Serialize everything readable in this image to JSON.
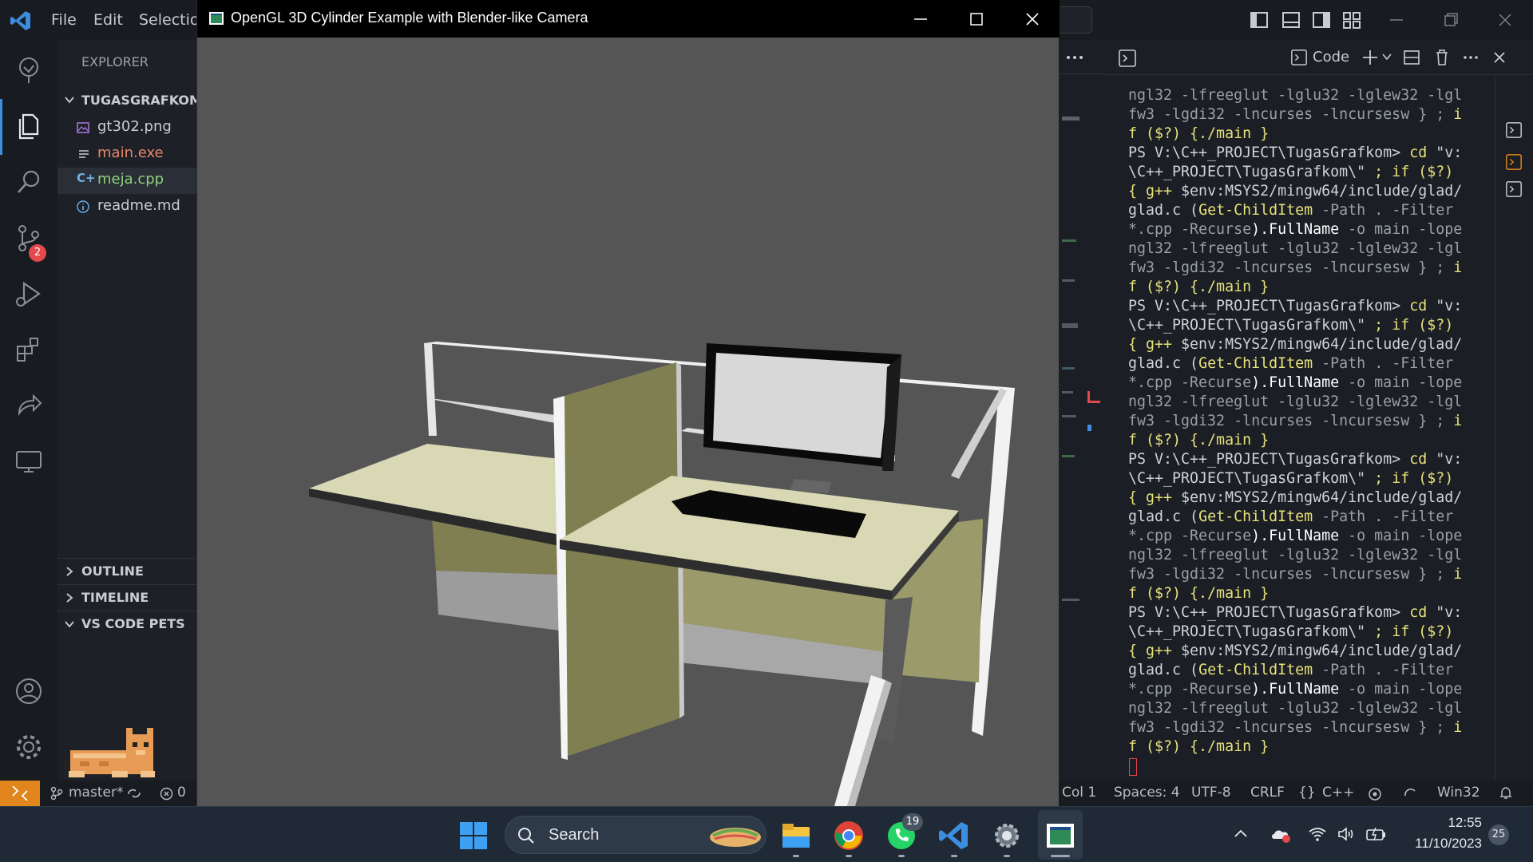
{
  "vscode": {
    "menu": [
      "File",
      "Edit",
      "Selectio"
    ],
    "explorer": {
      "header": "EXPLORER",
      "folder": "TUGASGRAFKOM",
      "files": [
        {
          "name": "gt302.png",
          "color": "#c9ccd2"
        },
        {
          "name": "main.exe",
          "color": "#e8866b"
        },
        {
          "name": "meja.cpp",
          "color": "#8fd17b"
        },
        {
          "name": "readme.md",
          "color": "#c9ccd2"
        }
      ],
      "sections": [
        "OUTLINE",
        "TIMELINE",
        "VS CODE PETS"
      ]
    },
    "scm_badge": "2",
    "terminal": {
      "profile_label": "Code",
      "lines": [
        [
          {
            "t": "ngl32 -lfreeglut -lglu32 -lglew32 -lgl",
            "c": "g"
          }
        ],
        [
          {
            "t": "fw3 -lgdi32 -lncurses -lncursesw } ; ",
            "c": "g"
          },
          {
            "t": "i",
            "c": "y"
          }
        ],
        [
          {
            "t": "f ($?) {./main }",
            "c": "y"
          }
        ],
        [
          {
            "t": "PS V:\\C++_PROJECT\\TugasGrafkom> ",
            "c": "n"
          },
          {
            "t": "cd ",
            "c": "y"
          },
          {
            "t": "\"v:",
            "c": "n"
          }
        ],
        [
          {
            "t": "\\C++_PROJECT\\TugasGrafkom\\\"",
            "c": "n"
          },
          {
            "t": " ; if ($?)",
            "c": "y"
          }
        ],
        [
          {
            "t": "{ g++ ",
            "c": "y"
          },
          {
            "t": "$env:MSYS2/mingw64/include/glad/",
            "c": "n"
          }
        ],
        [
          {
            "t": "glad.c (",
            "c": "n"
          },
          {
            "t": "Get-ChildItem",
            "c": "y"
          },
          {
            "t": " -Path . -Filter",
            "c": "g"
          }
        ],
        [
          {
            "t": "*.cpp -Recurse",
            "c": "g"
          },
          {
            "t": ").FullName",
            "c": "w"
          },
          {
            "t": " -o main -lope",
            "c": "g"
          }
        ],
        [
          {
            "t": "ngl32 -lfreeglut -lglu32 -lglew32 -lgl",
            "c": "g"
          }
        ],
        [
          {
            "t": "fw3 -lgdi32 -lncurses -lncursesw } ; ",
            "c": "g"
          },
          {
            "t": "i",
            "c": "y"
          }
        ],
        [
          {
            "t": "f ($?) {./main }",
            "c": "y"
          }
        ],
        [
          {
            "t": "PS V:\\C++_PROJECT\\TugasGrafkom> ",
            "c": "n"
          },
          {
            "t": "cd ",
            "c": "y"
          },
          {
            "t": "\"v:",
            "c": "n"
          }
        ],
        [
          {
            "t": "\\C++_PROJECT\\TugasGrafkom\\\"",
            "c": "n"
          },
          {
            "t": " ; if ($?)",
            "c": "y"
          }
        ],
        [
          {
            "t": "{ g++ ",
            "c": "y"
          },
          {
            "t": "$env:MSYS2/mingw64/include/glad/",
            "c": "n"
          }
        ],
        [
          {
            "t": "glad.c (",
            "c": "n"
          },
          {
            "t": "Get-ChildItem",
            "c": "y"
          },
          {
            "t": " -Path . -Filter",
            "c": "g"
          }
        ],
        [
          {
            "t": "*.cpp -Recurse",
            "c": "g"
          },
          {
            "t": ").FullName",
            "c": "w"
          },
          {
            "t": " -o main -lope",
            "c": "g"
          }
        ],
        [
          {
            "t": "ngl32 -lfreeglut -lglu32 -lglew32 -lgl",
            "c": "g"
          }
        ],
        [
          {
            "t": "fw3 -lgdi32 -lncurses -lncursesw } ; ",
            "c": "g"
          },
          {
            "t": "i",
            "c": "y"
          }
        ],
        [
          {
            "t": "f ($?) {./main }",
            "c": "y"
          }
        ],
        [
          {
            "t": "PS V:\\C++_PROJECT\\TugasGrafkom> ",
            "c": "n"
          },
          {
            "t": "cd ",
            "c": "y"
          },
          {
            "t": "\"v:",
            "c": "n"
          }
        ],
        [
          {
            "t": "\\C++_PROJECT\\TugasGrafkom\\\"",
            "c": "n"
          },
          {
            "t": " ; if ($?)",
            "c": "y"
          }
        ],
        [
          {
            "t": "{ g++ ",
            "c": "y"
          },
          {
            "t": "$env:MSYS2/mingw64/include/glad/",
            "c": "n"
          }
        ],
        [
          {
            "t": "glad.c (",
            "c": "n"
          },
          {
            "t": "Get-ChildItem",
            "c": "y"
          },
          {
            "t": " -Path . -Filter",
            "c": "g"
          }
        ],
        [
          {
            "t": "*.cpp -Recurse",
            "c": "g"
          },
          {
            "t": ").FullName",
            "c": "w"
          },
          {
            "t": " -o main -lope",
            "c": "g"
          }
        ],
        [
          {
            "t": "ngl32 -lfreeglut -lglu32 -lglew32 -lgl",
            "c": "g"
          }
        ],
        [
          {
            "t": "fw3 -lgdi32 -lncurses -lncursesw } ; ",
            "c": "g"
          },
          {
            "t": "i",
            "c": "y"
          }
        ],
        [
          {
            "t": "f ($?) {./main }",
            "c": "y"
          }
        ],
        [
          {
            "t": "PS V:\\C++_PROJECT\\TugasGrafkom> ",
            "c": "n"
          },
          {
            "t": "cd ",
            "c": "y"
          },
          {
            "t": "\"v:",
            "c": "n"
          }
        ],
        [
          {
            "t": "\\C++_PROJECT\\TugasGrafkom\\\"",
            "c": "n"
          },
          {
            "t": " ; if ($?)",
            "c": "y"
          }
        ],
        [
          {
            "t": "{ g++ ",
            "c": "y"
          },
          {
            "t": "$env:MSYS2/mingw64/include/glad/",
            "c": "n"
          }
        ],
        [
          {
            "t": "glad.c (",
            "c": "n"
          },
          {
            "t": "Get-ChildItem",
            "c": "y"
          },
          {
            "t": " -Path . -Filter",
            "c": "g"
          }
        ],
        [
          {
            "t": "*.cpp -Recurse",
            "c": "g"
          },
          {
            "t": ").FullName",
            "c": "w"
          },
          {
            "t": " -o main -lope",
            "c": "g"
          }
        ],
        [
          {
            "t": "ngl32 -lfreeglut -lglu32 -lglew32 -lgl",
            "c": "g"
          }
        ],
        [
          {
            "t": "fw3 -lgdi32 -lncurses -lncursesw } ; ",
            "c": "g"
          },
          {
            "t": "i",
            "c": "y"
          }
        ],
        [
          {
            "t": "f ($?) {./main }",
            "c": "y"
          }
        ]
      ]
    },
    "statusbar": {
      "branch": "master*",
      "errors": "0",
      "col": "Col 1",
      "spaces": "Spaces: 4",
      "encoding": "UTF-8",
      "eol": "CRLF",
      "language": "C++",
      "platform": "Win32"
    }
  },
  "glwindow": {
    "title": "OpenGL 3D Cylinder Example with Blender-like Camera",
    "background": "#555555"
  },
  "taskbar": {
    "search_label": "Search",
    "whatsapp_badge": "19",
    "time": "12:55",
    "date": "11/10/2023",
    "notification_count": "25"
  },
  "colors": {
    "accent_blue": "#3c8fe0",
    "badge_red": "#e5484d",
    "status_orange": "#e0861c",
    "desk_top": "#d9d8b4",
    "panel_olive": "#7f7f52"
  }
}
